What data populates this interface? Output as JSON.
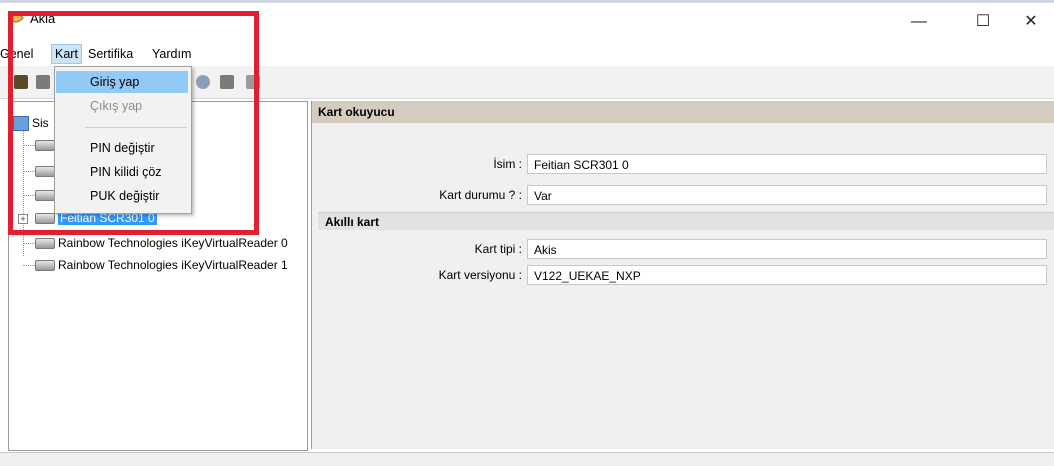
{
  "window": {
    "title": "Akia",
    "minimize_icon": "minimize-icon",
    "maximize_icon": "maximize-icon",
    "close_icon": "close-icon"
  },
  "menubar": {
    "items": [
      "Genel",
      "Kart",
      "Sertifika",
      "Yardım"
    ],
    "active": "Kart"
  },
  "dropdown": {
    "items": [
      {
        "label": "Giriş yap",
        "state": "highlighted"
      },
      {
        "label": "Çıkış yap",
        "state": "disabled"
      },
      {
        "label": "PIN değiştir",
        "state": "normal"
      },
      {
        "label": "PIN kilidi çöz",
        "state": "normal"
      },
      {
        "label": "PUK değiştir",
        "state": "normal"
      }
    ]
  },
  "tree": {
    "root_label": "Sis",
    "selected_label": "Feitian SCR301 0",
    "items": [
      "Rainbow Technologies iKeyVirtualReader 0",
      "Rainbow Technologies iKeyVirtualReader 1"
    ]
  },
  "detail": {
    "header": "Kart okuyucu",
    "fields": [
      {
        "label": "İsim :",
        "value": "Feitian SCR301 0"
      },
      {
        "label": "Kart durumu ? :",
        "value": "Var"
      }
    ],
    "section_title": "Akıllı kart",
    "section_fields": [
      {
        "label": "Kart tipi :",
        "value": "Akis"
      },
      {
        "label": "Kart versiyonu :",
        "value": "V122_UEKAE_NXP"
      }
    ]
  },
  "colors": {
    "highlight_frame": "#e02030",
    "selection": "#3399ff",
    "header_bg": "#d4cdbf"
  }
}
